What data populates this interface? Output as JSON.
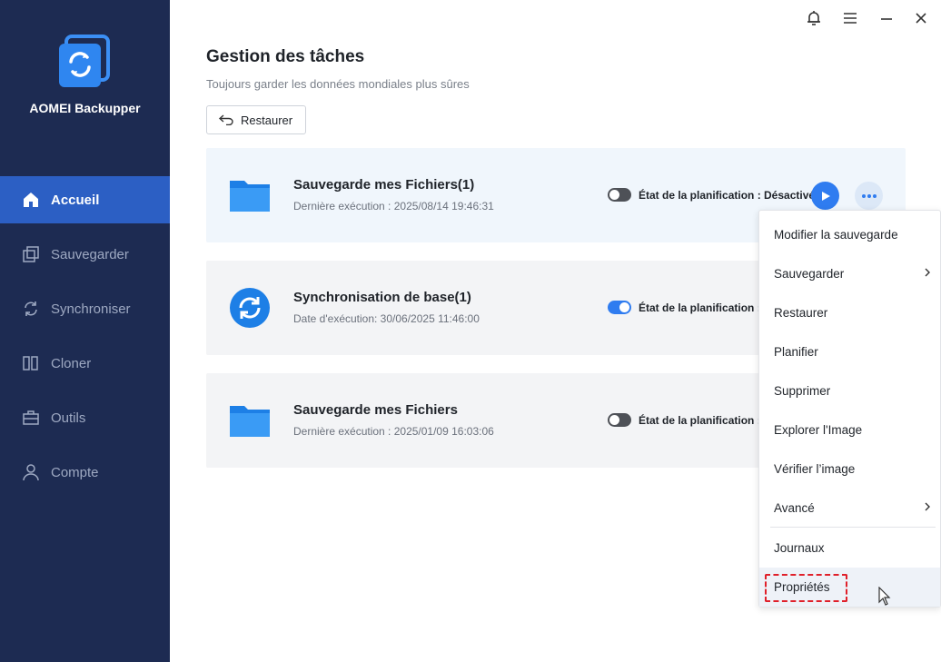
{
  "app": {
    "name": "AOMEI Backupper"
  },
  "sidebar": {
    "items": [
      {
        "label": "Accueil",
        "icon": "home-icon",
        "active": true
      },
      {
        "label": "Sauvegarder",
        "icon": "backup-icon",
        "active": false
      },
      {
        "label": "Synchroniser",
        "icon": "sync-icon",
        "active": false
      },
      {
        "label": "Cloner",
        "icon": "clone-icon",
        "active": false
      },
      {
        "label": "Outils",
        "icon": "tools-icon",
        "active": false
      },
      {
        "label": "Compte",
        "icon": "user-icon",
        "active": false
      }
    ]
  },
  "titlebar": {
    "icons": [
      "bell-icon",
      "menu-icon",
      "minimize-icon",
      "close-icon"
    ]
  },
  "header": {
    "title": "Gestion des tâches",
    "subtitle": "Toujours garder les données mondiales plus sûres",
    "restore_label": "Restaurer"
  },
  "tasks": [
    {
      "title": "Sauvegarde mes Fichiers(1)",
      "subtitle": "Dernière exécution : 2025/08/14 19:46:31",
      "icon": "folder-icon",
      "schedule_enabled": false,
      "schedule_text": "État de la planification : Désactivé"
    },
    {
      "title": "Synchronisation de base(1)",
      "subtitle": "Date d'exécution: 30/06/2025 11:46:00",
      "icon": "sync-circle-icon",
      "schedule_enabled": true,
      "schedule_text": "État de la planification : A"
    },
    {
      "title": "Sauvegarde mes Fichiers",
      "subtitle": "Dernière exécution : 2025/01/09 16:03:06",
      "icon": "folder-icon",
      "schedule_enabled": false,
      "schedule_text": "État de la planification : D"
    }
  ],
  "context_menu": {
    "items": [
      {
        "label": "Modifier la sauvegarde",
        "submenu": false
      },
      {
        "label": "Sauvegarder",
        "submenu": true
      },
      {
        "label": "Restaurer",
        "submenu": false
      },
      {
        "label": "Planifier",
        "submenu": false
      },
      {
        "label": "Supprimer",
        "submenu": false
      },
      {
        "label": "Explorer l'Image",
        "submenu": false
      },
      {
        "label": "Vérifier l’image",
        "submenu": false
      },
      {
        "label": "Avancé",
        "submenu": true
      },
      {
        "label": "Journaux",
        "submenu": false
      },
      {
        "label": "Propriétés",
        "submenu": false,
        "hover": true,
        "highlighted": true
      }
    ]
  },
  "colors": {
    "sidebar_bg": "#1d2b52",
    "active_nav": "#2c5fc4",
    "accent": "#2f7cf0",
    "highlight_box": "#e0202a"
  }
}
